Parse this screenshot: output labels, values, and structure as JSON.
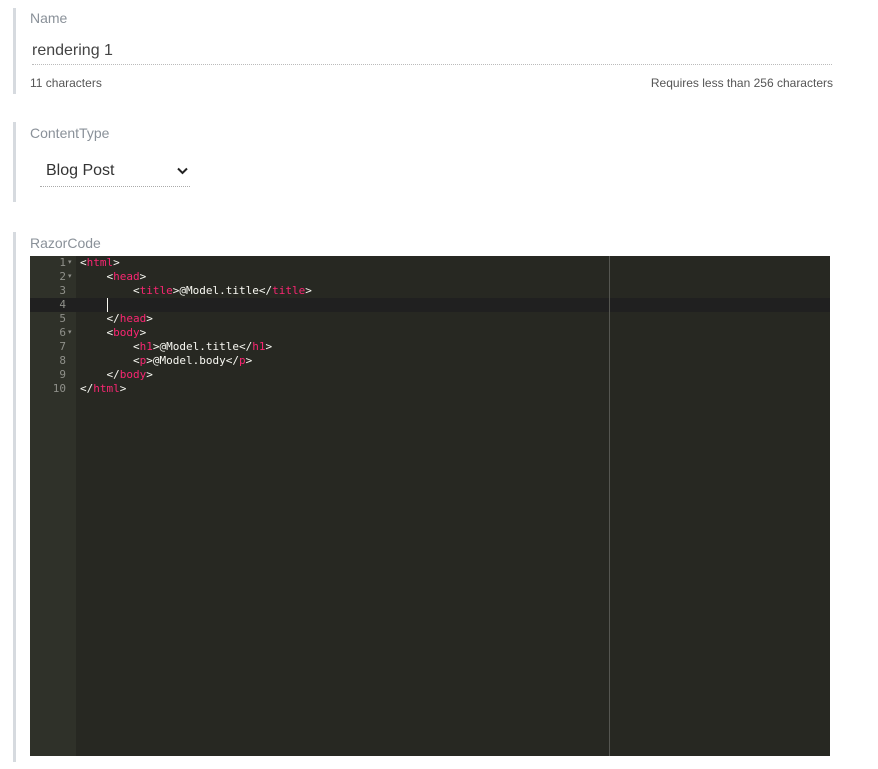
{
  "name_field": {
    "label": "Name",
    "value": "rendering 1",
    "char_count": "11 characters",
    "limit_hint": "Requires less than 256 characters"
  },
  "content_type": {
    "label": "ContentType",
    "selected": "Blog Post",
    "chevron_icon": "chevron-down-icon"
  },
  "razor_code": {
    "label": "RazorCode",
    "line_numbers": [
      "1",
      "2",
      "3",
      "4",
      "5",
      "6",
      "7",
      "8",
      "9",
      "10"
    ],
    "lines": [
      {
        "indent": "",
        "tokens": [
          {
            "t": "<",
            "c": "p"
          },
          {
            "t": "html",
            "c": "tag"
          },
          {
            "t": ">",
            "c": "p"
          }
        ]
      },
      {
        "indent": "    ",
        "tokens": [
          {
            "t": "<",
            "c": "p"
          },
          {
            "t": "head",
            "c": "tag"
          },
          {
            "t": ">",
            "c": "p"
          }
        ]
      },
      {
        "indent": "        ",
        "tokens": [
          {
            "t": "<",
            "c": "p"
          },
          {
            "t": "title",
            "c": "tag"
          },
          {
            "t": ">",
            "c": "p"
          },
          {
            "t": "@Model.title",
            "c": "p"
          },
          {
            "t": "</",
            "c": "p"
          },
          {
            "t": "title",
            "c": "tag"
          },
          {
            "t": ">",
            "c": "p"
          }
        ]
      },
      {
        "indent": "",
        "tokens": []
      },
      {
        "indent": "    ",
        "tokens": [
          {
            "t": "</",
            "c": "p"
          },
          {
            "t": "head",
            "c": "tag"
          },
          {
            "t": ">",
            "c": "p"
          }
        ]
      },
      {
        "indent": "    ",
        "tokens": [
          {
            "t": "<",
            "c": "p"
          },
          {
            "t": "body",
            "c": "tag"
          },
          {
            "t": ">",
            "c": "p"
          }
        ]
      },
      {
        "indent": "        ",
        "tokens": [
          {
            "t": "<",
            "c": "p"
          },
          {
            "t": "h1",
            "c": "tag"
          },
          {
            "t": ">",
            "c": "p"
          },
          {
            "t": "@Model.title",
            "c": "p"
          },
          {
            "t": "</",
            "c": "p"
          },
          {
            "t": "h1",
            "c": "tag"
          },
          {
            "t": ">",
            "c": "p"
          }
        ]
      },
      {
        "indent": "        ",
        "tokens": [
          {
            "t": "<",
            "c": "p"
          },
          {
            "t": "p",
            "c": "tag"
          },
          {
            "t": ">",
            "c": "p"
          },
          {
            "t": "@Model.body",
            "c": "p"
          },
          {
            "t": "</",
            "c": "p"
          },
          {
            "t": "p",
            "c": "tag"
          },
          {
            "t": ">",
            "c": "p"
          }
        ]
      },
      {
        "indent": "    ",
        "tokens": [
          {
            "t": "</",
            "c": "p"
          },
          {
            "t": "body",
            "c": "tag"
          },
          {
            "t": ">",
            "c": "p"
          }
        ]
      },
      {
        "indent": "",
        "tokens": [
          {
            "t": "</",
            "c": "p"
          },
          {
            "t": "html",
            "c": "tag"
          },
          {
            "t": ">",
            "c": "p"
          }
        ]
      }
    ],
    "fold_lines": [
      1,
      2,
      6
    ],
    "active_line": 4,
    "colors": {
      "background": "#272822",
      "gutter": "#2f3129",
      "tag": "#f92672",
      "text": "#f8f8f2"
    }
  }
}
